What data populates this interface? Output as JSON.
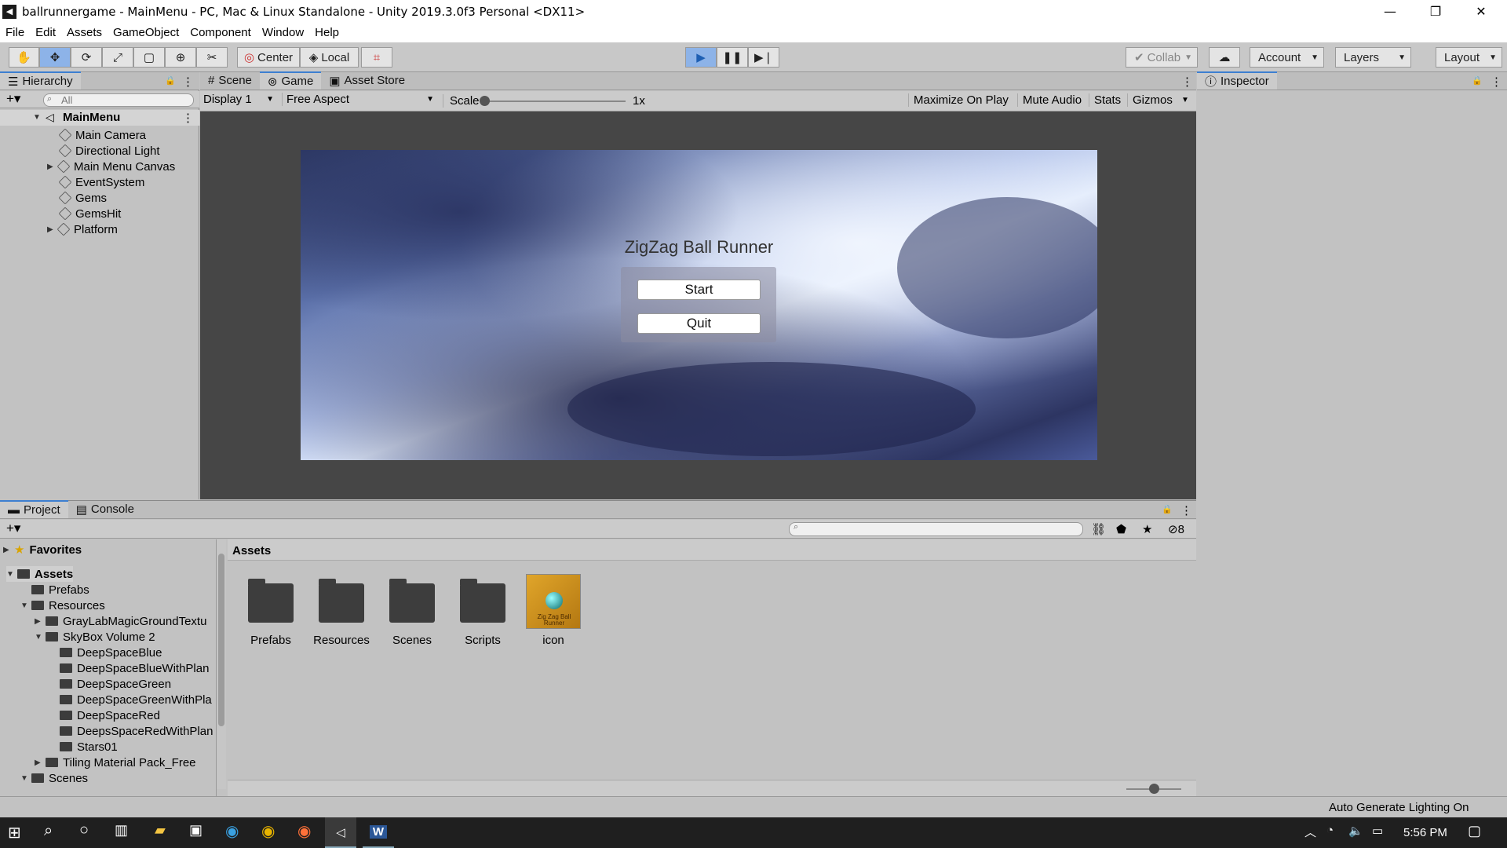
{
  "window": {
    "title": "ballrunnergame - MainMenu - PC, Mac & Linux Standalone - Unity 2019.3.0f3 Personal <DX11>"
  },
  "menu": [
    "File",
    "Edit",
    "Assets",
    "GameObject",
    "Component",
    "Window",
    "Help"
  ],
  "toolbar": {
    "pivot_label": "Center",
    "space_label": "Local",
    "collab_label": "Collab",
    "account_label": "Account",
    "layers_label": "Layers",
    "layout_label": "Layout"
  },
  "hierarchy": {
    "tab": "Hierarchy",
    "search_placeholder": "All",
    "scene": "MainMenu",
    "items": [
      "Main Camera",
      "Directional Light",
      "Main Menu Canvas",
      "EventSystem",
      "Gems",
      "GemsHit",
      "Platform"
    ]
  },
  "game": {
    "tabs": [
      "Scene",
      "Game",
      "Asset Store"
    ],
    "display": "Display 1",
    "aspect": "Free Aspect",
    "scale_label": "Scale",
    "scale_value": "1x",
    "options": [
      "Maximize On Play",
      "Mute Audio",
      "Stats",
      "Gizmos"
    ],
    "menu_title": "ZigZag Ball Runner",
    "start_label": "Start",
    "quit_label": "Quit"
  },
  "inspector": {
    "tab": "Inspector"
  },
  "project": {
    "tabs": [
      "Project",
      "Console"
    ],
    "favorites": "Favorites",
    "tree": [
      {
        "label": "Assets",
        "indent": 0,
        "expanded": true
      },
      {
        "label": "Prefabs",
        "indent": 1,
        "expanded": null
      },
      {
        "label": "Resources",
        "indent": 1,
        "expanded": true
      },
      {
        "label": "GrayLabMagicGroundTextu",
        "indent": 2,
        "expanded": false
      },
      {
        "label": "SkyBox Volume 2",
        "indent": 2,
        "expanded": true
      },
      {
        "label": "DeepSpaceBlue",
        "indent": 3,
        "expanded": null
      },
      {
        "label": "DeepSpaceBlueWithPlan",
        "indent": 3,
        "expanded": null
      },
      {
        "label": "DeepSpaceGreen",
        "indent": 3,
        "expanded": null
      },
      {
        "label": "DeepSpaceGreenWithPla",
        "indent": 3,
        "expanded": null
      },
      {
        "label": "DeepSpaceRed",
        "indent": 3,
        "expanded": null
      },
      {
        "label": "DeepsSpaceRedWithPlan",
        "indent": 3,
        "expanded": null
      },
      {
        "label": "Stars01",
        "indent": 3,
        "expanded": null
      },
      {
        "label": "Tiling Material Pack_Free",
        "indent": 2,
        "expanded": false
      },
      {
        "label": "Scenes",
        "indent": 1,
        "expanded": true
      }
    ],
    "breadcrumb": "Assets",
    "assets": [
      "Prefabs",
      "Resources",
      "Scenes",
      "Scripts",
      "icon"
    ],
    "hidden_count": "8",
    "icon_thumb_text": "Zig Zag Ball Runner"
  },
  "status": {
    "text": "Auto Generate Lighting On"
  },
  "taskbar": {
    "time": "5:56 PM"
  }
}
